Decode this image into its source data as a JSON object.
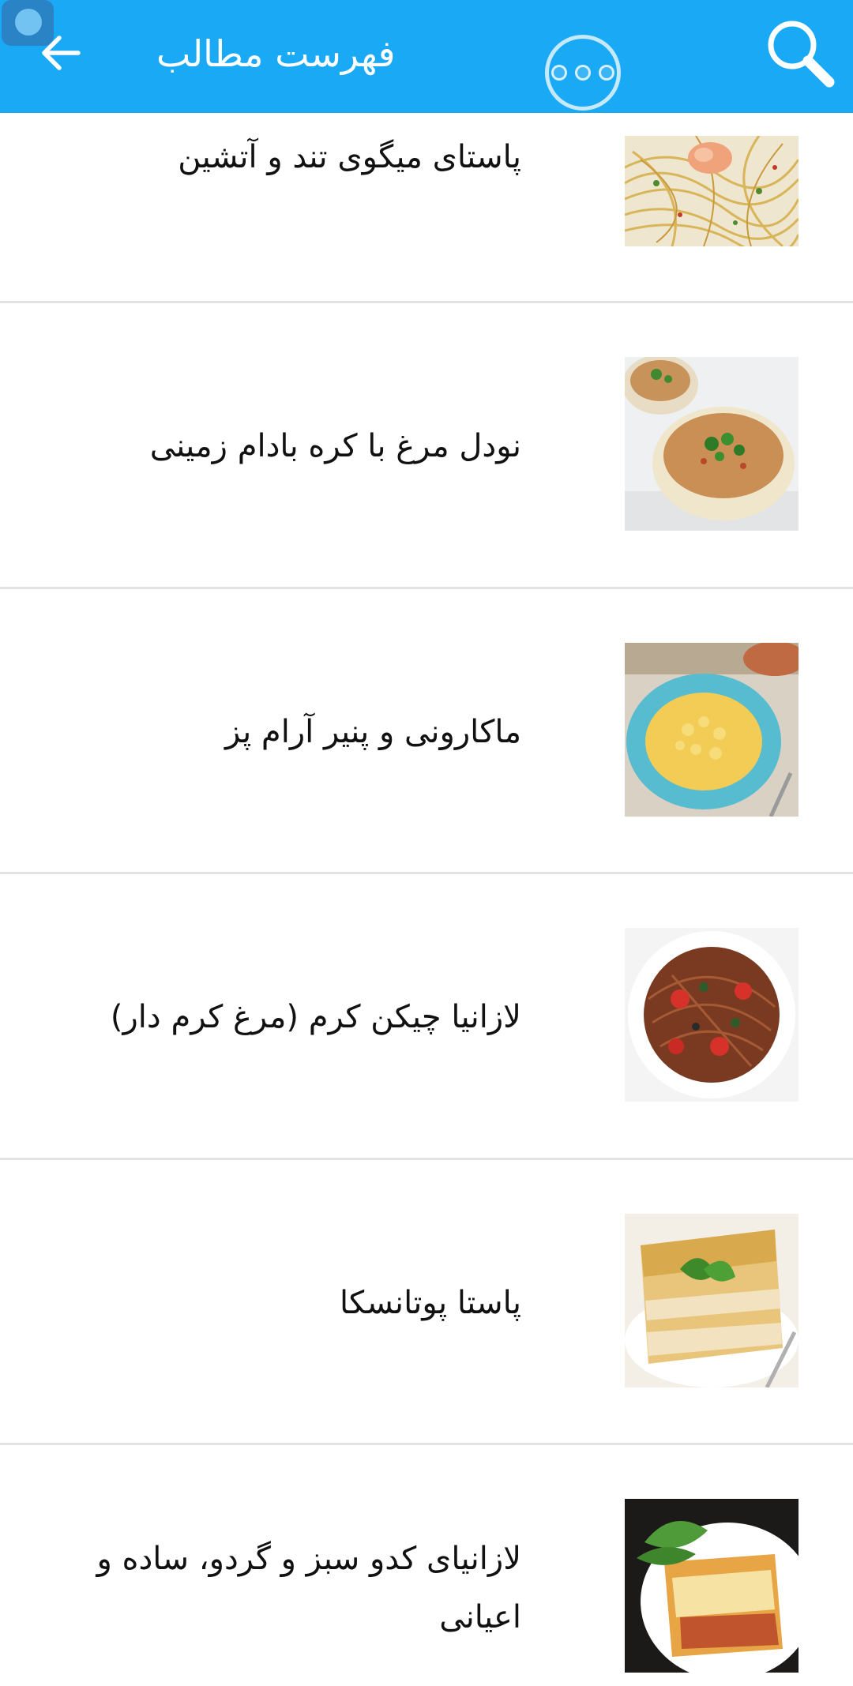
{
  "header": {
    "title": "فهرست مطالب",
    "back_icon": "arrow-left-icon",
    "search_icon": "search-icon",
    "overflow_icon": "more-dots-icon",
    "background": "#1aa9f5"
  },
  "recipes": [
    {
      "title": "پاستای میگوی تند و آتشین",
      "image": "shrimp-spaghetti"
    },
    {
      "title": "نودل مرغ با کره بادام زمینی",
      "image": "noodle-bowls"
    },
    {
      "title": "ماکارونی و پنیر آرام پز",
      "image": "mac-and-cheese"
    },
    {
      "title": "لازانیا چیکن کرم (مرغ کرم دار)",
      "image": "spaghetti-tomato"
    },
    {
      "title": "پاستا پوتانسکا",
      "image": "lasagna-slice"
    },
    {
      "title": "لازانیای کدو سبز و گردو، ساده و اعیانی",
      "image": "lasagna-plate"
    }
  ]
}
